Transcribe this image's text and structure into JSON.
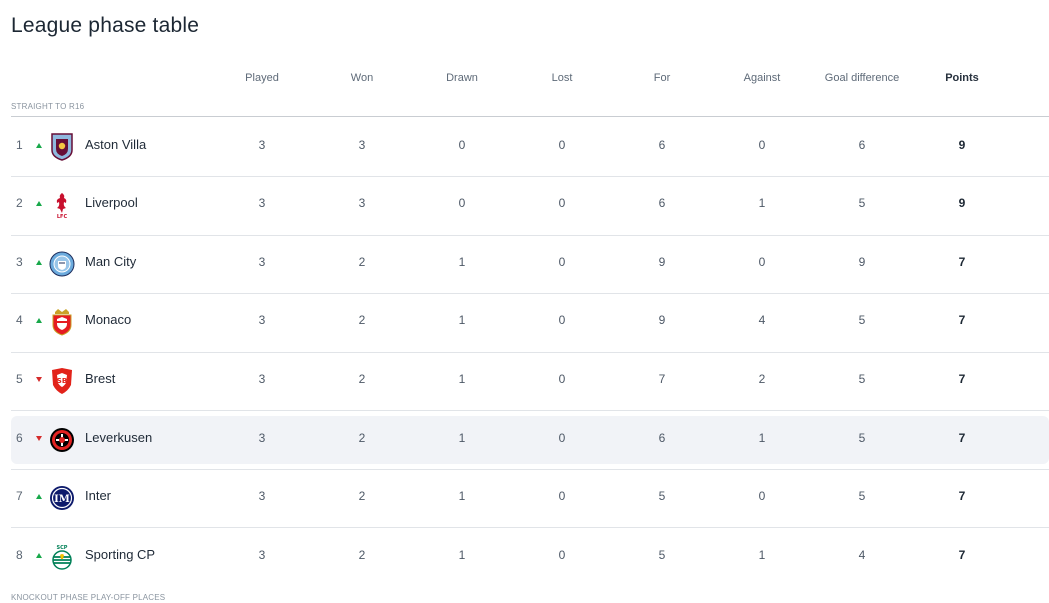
{
  "page_title": "League phase table",
  "columns": {
    "played": "Played",
    "won": "Won",
    "drawn": "Drawn",
    "lost": "Lost",
    "for": "For",
    "against": "Against",
    "goal_difference": "Goal difference",
    "points": "Points"
  },
  "sections": {
    "top": "STRAIGHT TO R16",
    "bottom": "KNOCKOUT PHASE PLAY-OFF PLACES"
  },
  "rows": [
    {
      "rank": "1",
      "trend": "up",
      "team": "Aston Villa",
      "crest": "aston-villa-crest-icon",
      "played": "3",
      "won": "3",
      "drawn": "0",
      "lost": "0",
      "for": "6",
      "against": "0",
      "gd": "6",
      "points": "9"
    },
    {
      "rank": "2",
      "trend": "up",
      "team": "Liverpool",
      "crest": "liverpool-crest-icon",
      "played": "3",
      "won": "3",
      "drawn": "0",
      "lost": "0",
      "for": "6",
      "against": "1",
      "gd": "5",
      "points": "9"
    },
    {
      "rank": "3",
      "trend": "up",
      "team": "Man City",
      "crest": "man-city-crest-icon",
      "played": "3",
      "won": "2",
      "drawn": "1",
      "lost": "0",
      "for": "9",
      "against": "0",
      "gd": "9",
      "points": "7"
    },
    {
      "rank": "4",
      "trend": "up",
      "team": "Monaco",
      "crest": "monaco-crest-icon",
      "played": "3",
      "won": "2",
      "drawn": "1",
      "lost": "0",
      "for": "9",
      "against": "4",
      "gd": "5",
      "points": "7"
    },
    {
      "rank": "5",
      "trend": "down",
      "team": "Brest",
      "crest": "brest-crest-icon",
      "played": "3",
      "won": "2",
      "drawn": "1",
      "lost": "0",
      "for": "7",
      "against": "2",
      "gd": "5",
      "points": "7"
    },
    {
      "rank": "6",
      "trend": "down",
      "team": "Leverkusen",
      "crest": "leverkusen-crest-icon",
      "played": "3",
      "won": "2",
      "drawn": "1",
      "lost": "0",
      "for": "6",
      "against": "1",
      "gd": "5",
      "points": "7"
    },
    {
      "rank": "7",
      "trend": "up",
      "team": "Inter",
      "crest": "inter-crest-icon",
      "played": "3",
      "won": "2",
      "drawn": "1",
      "lost": "0",
      "for": "5",
      "against": "0",
      "gd": "5",
      "points": "7"
    },
    {
      "rank": "8",
      "trend": "up",
      "team": "Sporting CP",
      "crest": "sporting-cp-crest-icon",
      "played": "3",
      "won": "2",
      "drawn": "1",
      "lost": "0",
      "for": "5",
      "against": "1",
      "gd": "4",
      "points": "7"
    }
  ],
  "colors": {
    "trend_up": "#18a84a",
    "trend_down": "#d52b2b",
    "highlight_row": "#f1f3f7"
  }
}
